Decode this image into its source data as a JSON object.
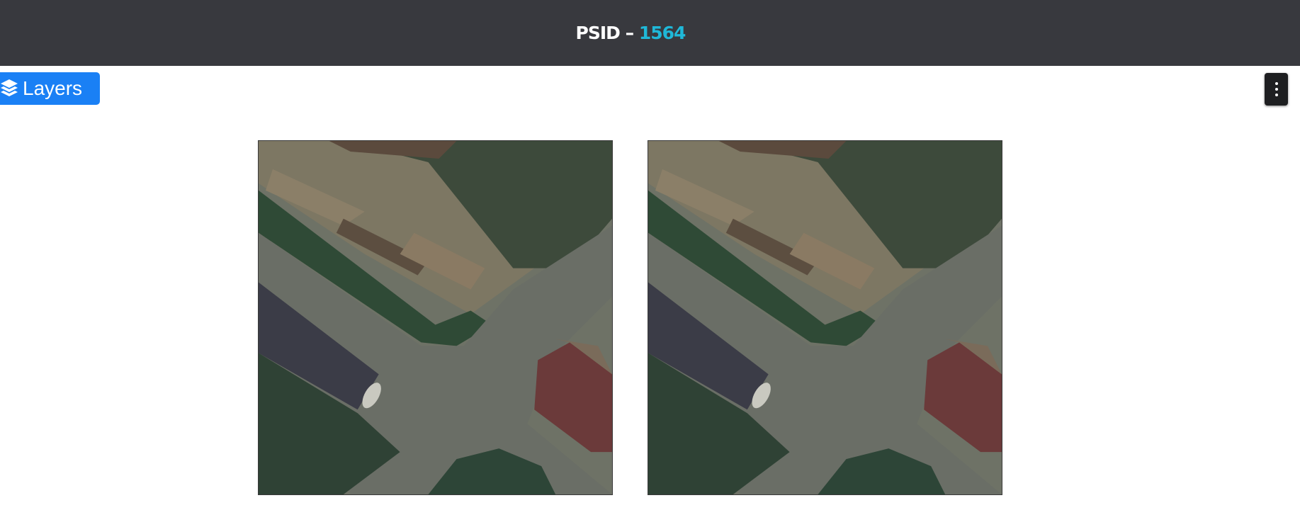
{
  "header": {
    "prefix": "PSID – ",
    "id_value": "1564",
    "accent_color": "#1fb8d8",
    "background_color": "#38393e"
  },
  "layers_button": {
    "label": "Layers",
    "icon": "layers-icon",
    "color": "#1a80f5"
  },
  "menu_button": {
    "icon": "vertical-ellipsis-icon"
  },
  "images": [
    {
      "name": "aerial-image-left"
    },
    {
      "name": "aerial-image-right"
    }
  ]
}
